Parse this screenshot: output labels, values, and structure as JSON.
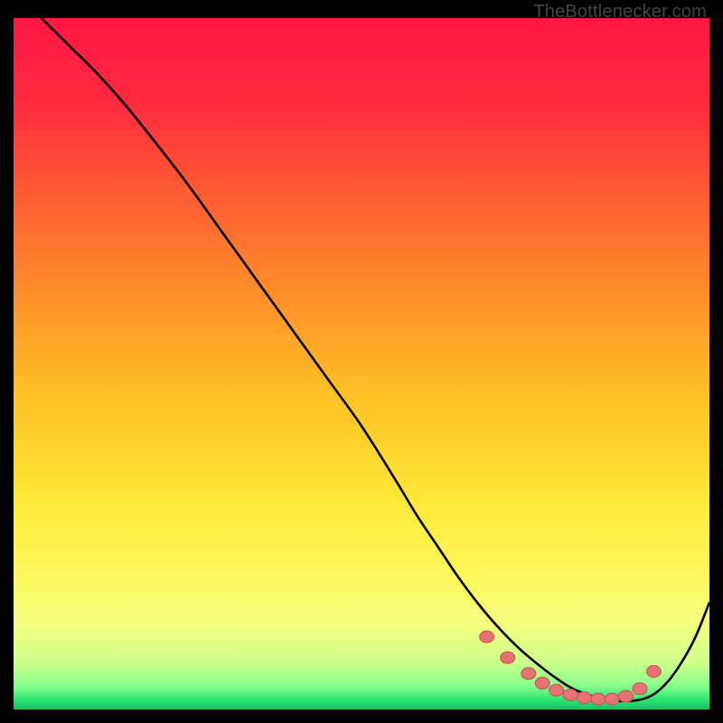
{
  "watermark": "TheBottlenecker.com",
  "chart_data": {
    "type": "line",
    "title": "",
    "xlabel": "",
    "ylabel": "",
    "xlim": [
      0,
      100
    ],
    "ylim": [
      0,
      100
    ],
    "grid": false,
    "legend": false,
    "background_gradient": {
      "stops": [
        {
          "offset": 0.0,
          "color": "#ff1744"
        },
        {
          "offset": 0.12,
          "color": "#ff2a3f"
        },
        {
          "offset": 0.25,
          "color": "#ff5a33"
        },
        {
          "offset": 0.4,
          "color": "#ff8f2a"
        },
        {
          "offset": 0.55,
          "color": "#ffc225"
        },
        {
          "offset": 0.7,
          "color": "#ffe838"
        },
        {
          "offset": 0.8,
          "color": "#fff85a"
        },
        {
          "offset": 0.88,
          "color": "#f2ff80"
        },
        {
          "offset": 0.93,
          "color": "#d0ff8a"
        },
        {
          "offset": 0.965,
          "color": "#8cff8c"
        },
        {
          "offset": 0.985,
          "color": "#30e876"
        },
        {
          "offset": 1.0,
          "color": "#18c060"
        }
      ]
    },
    "series": [
      {
        "name": "curve",
        "color": "#000000",
        "x": [
          4,
          8,
          12,
          16,
          20,
          25,
          30,
          35,
          40,
          45,
          50,
          55,
          58,
          61,
          64,
          67,
          70,
          73,
          76,
          78,
          80,
          82,
          84,
          86,
          88,
          90,
          92,
          94,
          96,
          98,
          100
        ],
        "y": [
          100,
          96,
          92,
          87.5,
          82.5,
          76,
          69,
          62,
          55,
          48,
          41,
          33,
          28,
          23.5,
          19,
          15,
          11.5,
          8.5,
          6,
          4.5,
          3.2,
          2.3,
          1.7,
          1.3,
          1.2,
          1.4,
          2.2,
          4.0,
          6.8,
          10.5,
          15.5
        ]
      }
    ],
    "scatter_points": {
      "color": "#e57373",
      "outline": "#c94f4f",
      "x": [
        68,
        71,
        74,
        76,
        78,
        80,
        82,
        84,
        86,
        88,
        90,
        92
      ],
      "y": [
        10.5,
        7.5,
        5.2,
        3.8,
        2.8,
        2.1,
        1.7,
        1.5,
        1.5,
        1.9,
        3.0,
        5.5
      ]
    }
  }
}
